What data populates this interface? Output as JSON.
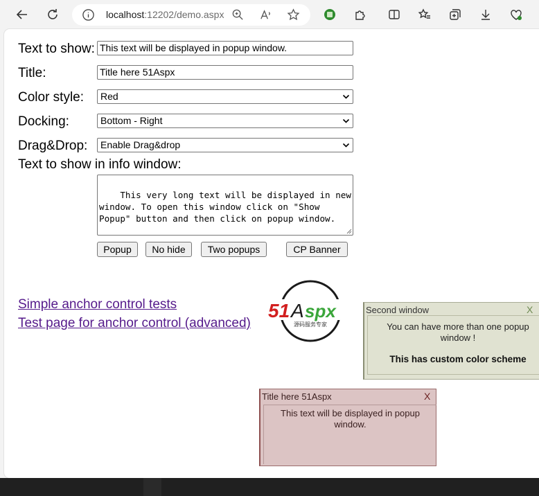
{
  "browser": {
    "url_host": "localhost",
    "url_rest": ":12202/demo.aspx"
  },
  "form": {
    "text_label": "Text to show:",
    "text_value": "This text will be displayed in popup window.",
    "title_label": "Title:",
    "title_value": "Title here 51Aspx",
    "color_label": "Color style:",
    "color_value": "Red",
    "docking_label": "Docking:",
    "docking_value": "Bottom - Right",
    "drag_label": "Drag&Drop:",
    "drag_value": "Enable Drag&drop",
    "info_label": "Text to show in info window:",
    "info_value": "This very long text will be displayed in new\nwindow. To open this window click on \"Show\nPopup\" button and then click on popup window."
  },
  "buttons": {
    "popup": "Popup",
    "no_hide": "No hide",
    "two_popups": "Two popups",
    "cp_banner": "CP Banner"
  },
  "links": {
    "simple": "Simple anchor control tests",
    "advanced": "Test page for anchor control (advanced)"
  },
  "logo": {
    "brand": "51Aspx",
    "tagline": "源码服务专家"
  },
  "popup_second": {
    "title": "Second window",
    "close": "X",
    "text": "You can have more than one popup window !",
    "bold_text": "This has custom color scheme",
    "bg_color": "#e0e2d1"
  },
  "popup_main": {
    "title": "Title here 51Aspx",
    "close": "X",
    "text": "This text will be displayed in popup window.",
    "bg_color": "#dcc4c4"
  }
}
